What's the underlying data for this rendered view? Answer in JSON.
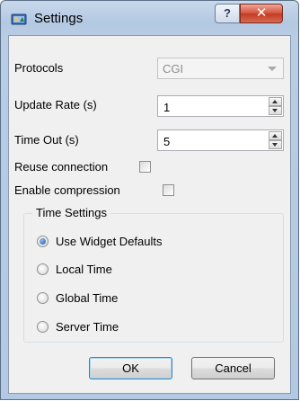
{
  "window": {
    "title": "Settings",
    "help_glyph": "?",
    "close_glyph": "✕"
  },
  "form": {
    "protocols_label": "Protocols",
    "protocols_value": "CGI",
    "update_rate_label": "Update Rate (s)",
    "update_rate_value": "1",
    "timeout_label": "Time Out (s)",
    "timeout_value": "5",
    "reuse_label": "Reuse connection",
    "reuse_checked": false,
    "compression_label": "Enable compression",
    "compression_checked": false
  },
  "time_settings": {
    "title": "Time Settings",
    "options": [
      {
        "label": "Use Widget Defaults",
        "selected": true
      },
      {
        "label": "Local Time",
        "selected": false
      },
      {
        "label": "Global Time",
        "selected": false
      },
      {
        "label": "Server Time",
        "selected": false
      }
    ]
  },
  "buttons": {
    "ok": "OK",
    "cancel": "Cancel"
  },
  "icons": {
    "app": "settings-app-icon",
    "help": "help-icon",
    "close": "close-icon",
    "combo_arrow": "chevron-down-icon",
    "spin_up": "spin-up-icon",
    "spin_down": "spin-down-icon"
  }
}
